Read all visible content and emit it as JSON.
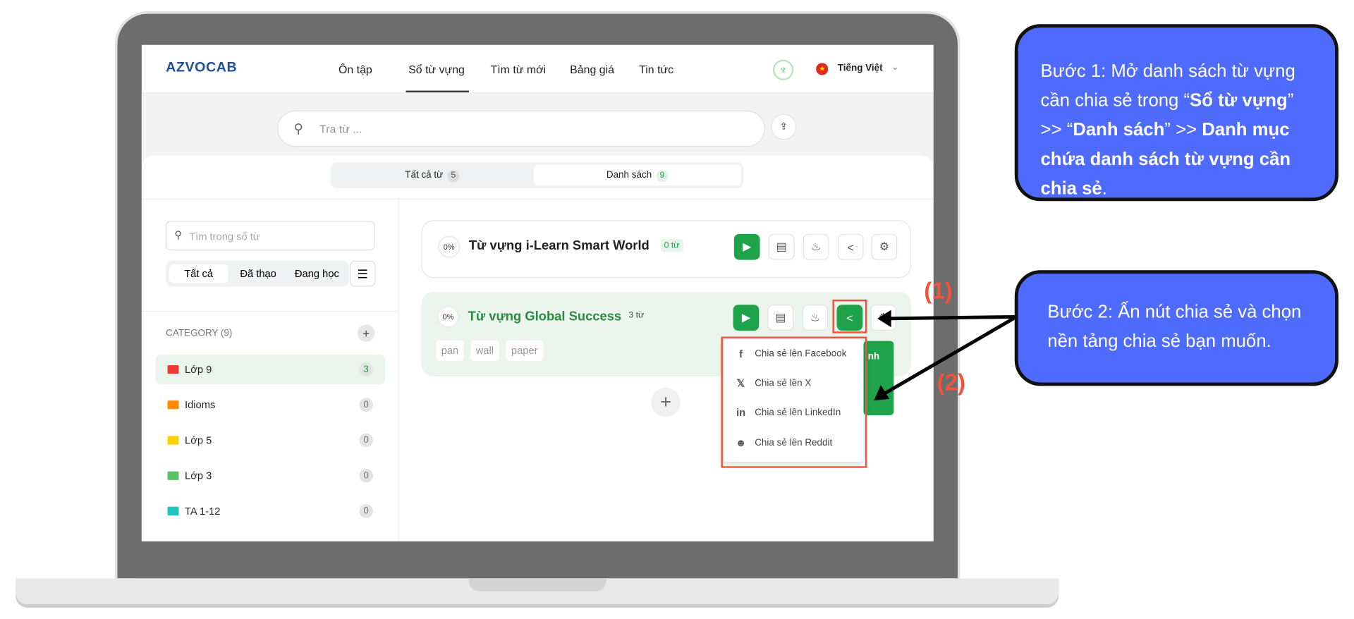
{
  "header": {
    "logo": "AZVOCAB",
    "nav": [
      "Ôn tập",
      "Sổ từ vựng",
      "Tìm từ mới",
      "Bảng giá",
      "Tin tức"
    ],
    "active_nav": "Sổ từ vựng",
    "language": "Tiếng Việt"
  },
  "search": {
    "placeholder": "Tra từ ..."
  },
  "tabs": [
    {
      "label": "Tất cả từ",
      "count": "5"
    },
    {
      "label": "Danh sách",
      "count": "9",
      "active": true
    }
  ],
  "sidebar": {
    "search_placeholder": "Tìm trong sổ từ",
    "filters": [
      "Tất cả",
      "Đã thạo",
      "Đang học"
    ],
    "category_title": "CATEGORY (9)",
    "categories": [
      {
        "name": "Lớp 9",
        "count": "3",
        "color": "#f03a32"
      },
      {
        "name": "Idioms",
        "count": "0",
        "color": "#ff8c00"
      },
      {
        "name": "Lớp 5",
        "count": "0",
        "color": "#ffd000"
      },
      {
        "name": "Lớp 3",
        "count": "0",
        "color": "#5cc068"
      },
      {
        "name": "TA 1-12",
        "count": "0",
        "color": "#1cc6c0"
      }
    ]
  },
  "lists": [
    {
      "progress": "0%",
      "title": "Từ vựng i-Learn Smart World",
      "count": "0 từ",
      "tags": []
    },
    {
      "progress": "0%",
      "title": "Từ vựng Global Success",
      "count": "3 từ",
      "tags": [
        "pan",
        "wall",
        "paper"
      ]
    }
  ],
  "hidden_button_fragment": "nh",
  "share_menu": [
    {
      "icon": "facebook-icon",
      "label": "Chia sẻ lên Facebook"
    },
    {
      "icon": "x-icon",
      "label": "Chia sẻ lên X"
    },
    {
      "icon": "linkedin-icon",
      "label": "Chia sẻ lên LinkedIn"
    },
    {
      "icon": "reddit-icon",
      "label": "Chia sẻ lên Reddit"
    }
  ],
  "annotations": {
    "marker1": "(1)",
    "marker2": "(2)",
    "step1": {
      "a": "Bước 1: Mở danh sách từ vựng cần chia sẻ trong “",
      "b": "Sổ từ vựng",
      "c": "” >> “",
      "d": "Danh sách",
      "e": "” >> ",
      "f": "Danh mục chứa danh sách từ vựng cần chia sẻ",
      "g": "."
    },
    "step2": "Bước 2: Ấn nút chia sẻ và chọn nền tảng chia sẻ bạn muốn."
  },
  "colors": {
    "accent": "#1fa34a",
    "callout": "#4f6bfe",
    "highlight": "#f0543a"
  }
}
